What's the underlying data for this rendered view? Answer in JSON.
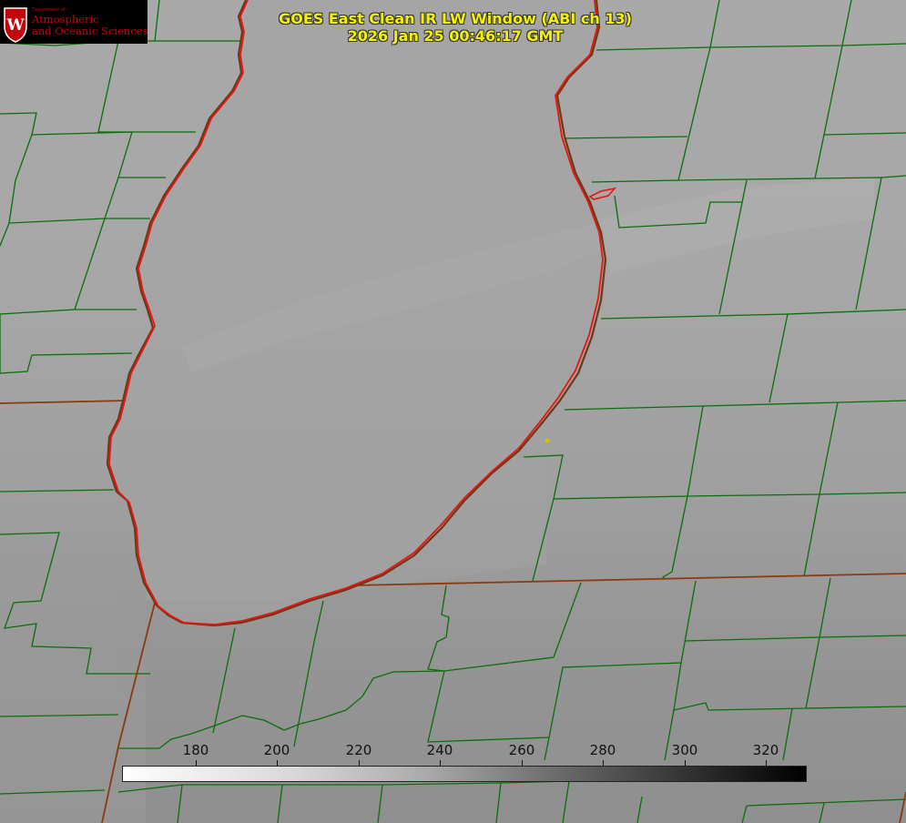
{
  "logo": {
    "department": "Department of",
    "line1": "Atmospheric",
    "line2": "and Oceanic Sciences",
    "emblem_letter": "W",
    "brand_color": "#c5050c"
  },
  "title": {
    "line1": "GOES East Clean IR LW Window (ABI ch 13)",
    "line2": "2026 Jan 25 00:46:17 GMT",
    "color": "#f2f200"
  },
  "colorbar": {
    "ticks": [
      "180",
      "200",
      "220",
      "240",
      "260",
      "280",
      "300",
      "320"
    ],
    "min_color": "#ffffff",
    "max_color": "#000000"
  },
  "map": {
    "county_border_color": "#0a6e0a",
    "coastline_color": "#e8140f",
    "state_border_color": "#8b3a10",
    "marker_color": "#d8c200"
  }
}
